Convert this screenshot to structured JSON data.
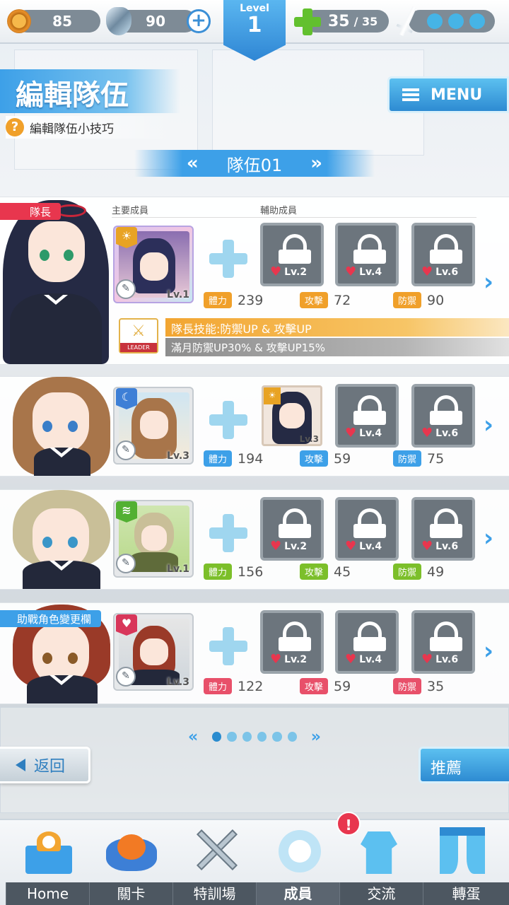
{
  "topbar": {
    "coins": "85",
    "gems": "90",
    "level_label": "Level",
    "level_value": "1",
    "stamina": "35",
    "stamina_max": "/ 35"
  },
  "header": {
    "title": "編輯隊伍",
    "tip": "編輯隊伍小技巧",
    "menu": "MENU",
    "team_name": "隊伍01",
    "prev_arrow": "«",
    "next_arrow": "»"
  },
  "labels": {
    "main_member": "主要成員",
    "support_member": "輔助成員",
    "hp": "體力",
    "atk": "攻擊",
    "def": "防禦"
  },
  "rows": [
    {
      "tag": "隊長",
      "main_lv": "Lv.1",
      "slots": [
        "Lv.2",
        "Lv.4",
        "Lv.6"
      ],
      "hp": "239",
      "atk": "72",
      "def": "90",
      "stat_color": "#f0a02a",
      "leader_skill": "隊長技能:防禦UP & 攻擊UP",
      "leader_desc": "滿月防禦UP30% & 攻擊UP15%",
      "leader_badge": "LEADER"
    },
    {
      "main_lv": "Lv.3",
      "sub_lv": "Lv.3",
      "slots": [
        "Lv.4",
        "Lv.6"
      ],
      "hp": "194",
      "atk": "59",
      "def": "75",
      "stat_color": "#3da0e8"
    },
    {
      "main_lv": "Lv.1",
      "slots": [
        "Lv.2",
        "Lv.4",
        "Lv.6"
      ],
      "hp": "156",
      "atk": "45",
      "def": "49",
      "stat_color": "#7cbf2a"
    },
    {
      "tag": "助戰角色變更欄",
      "main_lv": "Lv.3",
      "slots": [
        "Lv.2",
        "Lv.4",
        "Lv.6"
      ],
      "hp": "122",
      "atk": "59",
      "def": "35",
      "stat_color": "#e8506a"
    }
  ],
  "pager": {
    "prev": "«",
    "next": "»",
    "pages": 6,
    "current": 1
  },
  "buttons": {
    "back": "返回",
    "recommend": "推薦"
  },
  "nav": {
    "items": [
      "Home",
      "關卡",
      "特訓場",
      "成員",
      "交流",
      "轉蛋"
    ],
    "active": "成員",
    "notification": "!"
  }
}
